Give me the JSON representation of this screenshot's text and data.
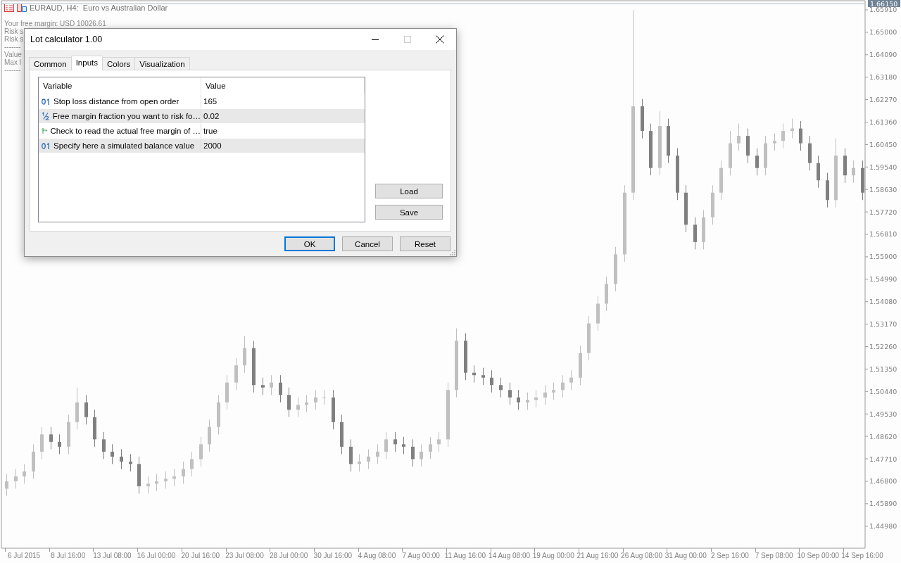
{
  "chart_header": {
    "title": "EURAUD, H4:  Euro vs Australian Dollar"
  },
  "info_lines": [
    "Your free margin: USD 10026.61",
    "Risk s",
    "Risk s",
    "-------",
    "Value",
    "Max l",
    "-------"
  ],
  "current_price": "1.66150",
  "chart_data": {
    "type": "candlestick",
    "ylim": [
      1.44116,
      1.66309
    ],
    "categories": [
      null,
      null,
      "6 Jul 2015",
      null,
      null,
      null,
      null,
      "8 Jul 16:00",
      null,
      null,
      null,
      null,
      "13 Jul 08:00",
      null,
      null,
      null,
      null,
      "16 Jul 00:00",
      null,
      null,
      null,
      null,
      "20 Jul 16:00",
      null,
      null,
      null,
      null,
      "23 Jul 08:00",
      null,
      null,
      null,
      null,
      "28 Jul 00:00",
      null,
      null,
      null,
      null,
      "30 Jul 16:00",
      null,
      null,
      null,
      null,
      "4 Aug 08:00",
      null,
      null,
      null,
      null,
      "7 Aug 00:00",
      null,
      null,
      null,
      null,
      "11 Aug 16:00",
      null,
      null,
      null,
      null,
      "14 Aug 08:00",
      null,
      null,
      null,
      null,
      "19 Aug 00:00",
      null,
      null,
      null,
      null,
      "21 Aug 16:00",
      null,
      null,
      null,
      null,
      "26 Aug 08:00",
      null,
      null,
      null,
      null,
      "31 Aug 00:00",
      null,
      null,
      null,
      null,
      "2 Sep 16:00",
      null,
      null,
      null,
      null,
      "7 Sep 08:00",
      null,
      null,
      null,
      null,
      "10 Sep 00:00",
      null,
      null,
      null,
      null,
      "14 Sep 16:00",
      null,
      null
    ],
    "yticks": [
      {
        "value": 1.6591,
        "label": "1.65910"
      },
      {
        "value": 1.65,
        "label": "1.65000"
      },
      {
        "value": 1.6409,
        "label": "1.64090"
      },
      {
        "value": 1.6318,
        "label": "1.63180"
      },
      {
        "value": 1.6227,
        "label": "1.62270"
      },
      {
        "value": 1.6136,
        "label": "1.61360"
      },
      {
        "value": 1.6045,
        "label": "1.60450"
      },
      {
        "value": 1.5954,
        "label": "1.59540"
      },
      {
        "value": 1.5863,
        "label": "1.58630"
      },
      {
        "value": 1.5772,
        "label": "1.57720"
      },
      {
        "value": 1.5681,
        "label": "1.56810"
      },
      {
        "value": 1.559,
        "label": "1.55900"
      },
      {
        "value": 1.5499,
        "label": "1.54990"
      },
      {
        "value": 1.5408,
        "label": "1.54080"
      },
      {
        "value": 1.5317,
        "label": "1.53170"
      },
      {
        "value": 1.5226,
        "label": "1.52260"
      },
      {
        "value": 1.5135,
        "label": "1.51350"
      },
      {
        "value": 1.5044,
        "label": "1.50440"
      },
      {
        "value": 1.4953,
        "label": "1.49530"
      },
      {
        "value": 1.4862,
        "label": "1.48620"
      },
      {
        "value": 1.4771,
        "label": "1.47710"
      },
      {
        "value": 1.468,
        "label": "1.46800"
      },
      {
        "value": 1.4589,
        "label": "1.45890"
      },
      {
        "value": 1.4498,
        "label": "1.44980"
      }
    ],
    "series": [
      {
        "ohlc": [
          [
            1.465,
            1.471,
            1.462,
            1.468
          ],
          [
            1.468,
            1.473,
            1.465,
            1.47
          ],
          [
            1.47,
            1.475,
            1.467,
            1.472
          ],
          [
            1.472,
            1.483,
            1.469,
            1.48
          ],
          [
            1.48,
            1.49,
            1.477,
            1.487
          ],
          [
            1.487,
            1.49,
            1.481,
            1.484
          ],
          [
            1.484,
            1.487,
            1.479,
            1.482
          ],
          [
            1.482,
            1.495,
            1.479,
            1.492
          ],
          [
            1.492,
            1.506,
            1.489,
            1.5
          ],
          [
            1.5,
            1.503,
            1.491,
            1.494
          ],
          [
            1.494,
            1.497,
            1.482,
            1.485
          ],
          [
            1.485,
            1.488,
            1.477,
            1.48
          ],
          [
            1.48,
            1.483,
            1.475,
            1.478
          ],
          [
            1.478,
            1.481,
            1.473,
            1.476
          ],
          [
            1.476,
            1.479,
            1.472,
            1.475
          ],
          [
            1.475,
            1.478,
            1.463,
            1.466
          ],
          [
            1.466,
            1.47,
            1.463,
            1.467
          ],
          [
            1.467,
            1.471,
            1.464,
            1.468
          ],
          [
            1.468,
            1.472,
            1.465,
            1.469
          ],
          [
            1.469,
            1.473,
            1.466,
            1.47
          ],
          [
            1.47,
            1.476,
            1.467,
            1.473
          ],
          [
            1.473,
            1.48,
            1.47,
            1.477
          ],
          [
            1.477,
            1.486,
            1.474,
            1.483
          ],
          [
            1.483,
            1.493,
            1.48,
            1.49
          ],
          [
            1.49,
            1.503,
            1.487,
            1.5
          ],
          [
            1.5,
            1.511,
            1.497,
            1.508
          ],
          [
            1.508,
            1.518,
            1.505,
            1.515
          ],
          [
            1.515,
            1.527,
            1.512,
            1.522
          ],
          [
            1.522,
            1.525,
            1.504,
            1.507
          ],
          [
            1.507,
            1.51,
            1.503,
            1.506
          ],
          [
            1.506,
            1.511,
            1.503,
            1.508
          ],
          [
            1.508,
            1.511,
            1.5,
            1.503
          ],
          [
            1.503,
            1.506,
            1.494,
            1.497
          ],
          [
            1.497,
            1.502,
            1.494,
            1.499
          ],
          [
            1.499,
            1.503,
            1.496,
            1.5
          ],
          [
            1.5,
            1.505,
            1.497,
            1.502
          ],
          [
            1.502,
            1.505,
            1.499,
            1.502
          ],
          [
            1.502,
            1.505,
            1.489,
            1.492
          ],
          [
            1.492,
            1.495,
            1.479,
            1.482
          ],
          [
            1.482,
            1.485,
            1.472,
            1.475
          ],
          [
            1.475,
            1.479,
            1.472,
            1.476
          ],
          [
            1.476,
            1.481,
            1.473,
            1.478
          ],
          [
            1.478,
            1.483,
            1.475,
            1.48
          ],
          [
            1.48,
            1.488,
            1.477,
            1.485
          ],
          [
            1.485,
            1.488,
            1.48,
            1.483
          ],
          [
            1.483,
            1.486,
            1.479,
            1.482
          ],
          [
            1.482,
            1.485,
            1.474,
            1.477
          ],
          [
            1.477,
            1.483,
            1.474,
            1.48
          ],
          [
            1.48,
            1.486,
            1.477,
            1.483
          ],
          [
            1.483,
            1.488,
            1.48,
            1.485
          ],
          [
            1.485,
            1.508,
            1.482,
            1.505
          ],
          [
            1.505,
            1.53,
            1.502,
            1.525
          ],
          [
            1.525,
            1.528,
            1.509,
            1.512
          ],
          [
            1.512,
            1.515,
            1.508,
            1.511
          ],
          [
            1.511,
            1.514,
            1.507,
            1.51
          ],
          [
            1.51,
            1.513,
            1.504,
            1.507
          ],
          [
            1.507,
            1.51,
            1.502,
            1.505
          ],
          [
            1.505,
            1.508,
            1.499,
            1.502
          ],
          [
            1.502,
            1.505,
            1.497,
            1.5
          ],
          [
            1.5,
            1.504,
            1.497,
            1.501
          ],
          [
            1.501,
            1.505,
            1.498,
            1.502
          ],
          [
            1.502,
            1.507,
            1.499,
            1.504
          ],
          [
            1.504,
            1.508,
            1.501,
            1.505
          ],
          [
            1.505,
            1.511,
            1.502,
            1.508
          ],
          [
            1.508,
            1.513,
            1.505,
            1.51
          ],
          [
            1.51,
            1.523,
            1.507,
            1.52
          ],
          [
            1.52,
            1.535,
            1.517,
            1.532
          ],
          [
            1.532,
            1.543,
            1.529,
            1.54
          ],
          [
            1.54,
            1.551,
            1.537,
            1.548
          ],
          [
            1.548,
            1.563,
            1.545,
            1.56
          ],
          [
            1.56,
            1.588,
            1.557,
            1.585
          ],
          [
            1.585,
            1.659,
            1.582,
            1.62
          ],
          [
            1.62,
            1.623,
            1.607,
            1.61
          ],
          [
            1.61,
            1.613,
            1.592,
            1.595
          ],
          [
            1.595,
            1.618,
            1.592,
            1.612
          ],
          [
            1.612,
            1.615,
            1.597,
            1.6
          ],
          [
            1.6,
            1.603,
            1.582,
            1.585
          ],
          [
            1.585,
            1.588,
            1.569,
            1.572
          ],
          [
            1.572,
            1.575,
            1.562,
            1.565
          ],
          [
            1.565,
            1.578,
            1.562,
            1.575
          ],
          [
            1.575,
            1.588,
            1.572,
            1.585
          ],
          [
            1.585,
            1.598,
            1.582,
            1.595
          ],
          [
            1.595,
            1.61,
            1.592,
            1.605
          ],
          [
            1.605,
            1.613,
            1.602,
            1.608
          ],
          [
            1.608,
            1.611,
            1.597,
            1.6
          ],
          [
            1.6,
            1.603,
            1.592,
            1.595
          ],
          [
            1.595,
            1.608,
            1.592,
            1.605
          ],
          [
            1.605,
            1.609,
            1.602,
            1.606
          ],
          [
            1.606,
            1.613,
            1.603,
            1.61
          ],
          [
            1.61,
            1.615,
            1.607,
            1.611
          ],
          [
            1.611,
            1.614,
            1.602,
            1.605
          ],
          [
            1.605,
            1.608,
            1.594,
            1.597
          ],
          [
            1.597,
            1.6,
            1.587,
            1.59
          ],
          [
            1.59,
            1.593,
            1.579,
            1.582
          ],
          [
            1.582,
            1.607,
            1.579,
            1.6
          ],
          [
            1.6,
            1.603,
            1.589,
            1.592
          ],
          [
            1.592,
            1.598,
            1.589,
            1.595
          ],
          [
            1.595,
            1.598,
            1.582,
            1.585
          ],
          null,
          null
        ]
      }
    ]
  },
  "dialog": {
    "title": "Lot calculator 1.00",
    "tabs": [
      {
        "label": "Common",
        "selected": false
      },
      {
        "label": "Inputs",
        "selected": true
      },
      {
        "label": "Colors",
        "selected": false
      },
      {
        "label": "Visualization",
        "selected": false
      }
    ],
    "columns": [
      "Variable",
      "Value"
    ],
    "rows": [
      {
        "kind": "integer",
        "variable": "Stop loss distance from open order",
        "value": "165"
      },
      {
        "kind": "double",
        "variable": "Free margin fraction you want to risk fo…",
        "value": "0.02"
      },
      {
        "kind": "bool",
        "variable": "Check to read the actual free margin of …",
        "value": "true"
      },
      {
        "kind": "integer",
        "variable": "Specify here a simulated balance value",
        "value": "2000"
      }
    ],
    "side_buttons": [
      "Load",
      "Save"
    ],
    "buttons": [
      {
        "label": "OK",
        "default": true
      },
      {
        "label": "Cancel",
        "default": false
      },
      {
        "label": "Reset",
        "default": false
      }
    ]
  }
}
